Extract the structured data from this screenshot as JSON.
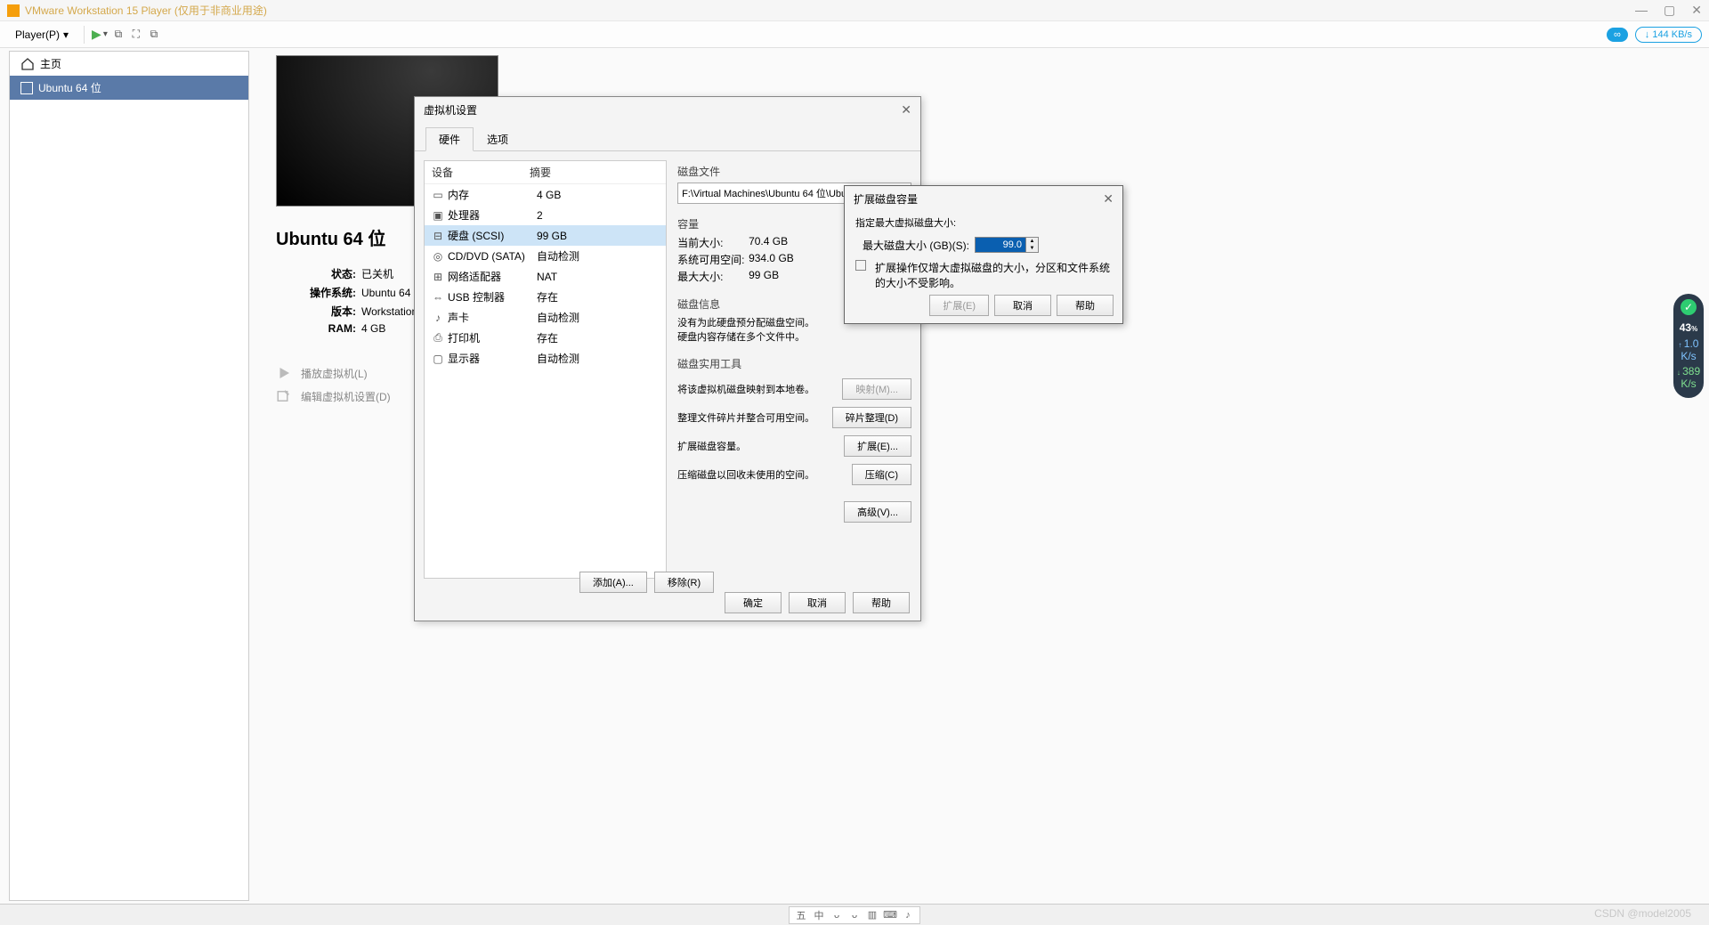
{
  "window": {
    "title": "VMware Workstation 15 Player (仅用于非商业用途)"
  },
  "toolbar": {
    "player_menu": "Player(P)",
    "net_speed": "↓ 144 KB/s"
  },
  "sidebar": {
    "home": "主页",
    "vm": "Ubuntu 64 位"
  },
  "vm": {
    "name": "Ubuntu 64 位",
    "state_label": "状态:",
    "state_value": "已关机",
    "os_label": "操作系统:",
    "os_value": "Ubuntu 64 位",
    "version_label": "版本:",
    "version_value": "Workstation 15.x 虚拟",
    "ram_label": "RAM:",
    "ram_value": "4 GB",
    "play": "播放虚拟机(L)",
    "edit": "编辑虚拟机设置(D)"
  },
  "settings": {
    "title": "虚拟机设置",
    "tab_hw": "硬件",
    "tab_opt": "选项",
    "col_device": "设备",
    "col_summary": "摘要",
    "devices": [
      {
        "name": "内存",
        "summary": "4 GB",
        "ico": "▭"
      },
      {
        "name": "处理器",
        "summary": "2",
        "ico": "▣"
      },
      {
        "name": "硬盘 (SCSI)",
        "summary": "99 GB",
        "ico": "⊟",
        "selected": true
      },
      {
        "name": "CD/DVD (SATA)",
        "summary": "自动检测",
        "ico": "◎"
      },
      {
        "name": "网络适配器",
        "summary": "NAT",
        "ico": "⊞"
      },
      {
        "name": "USB 控制器",
        "summary": "存在",
        "ico": "⇔"
      },
      {
        "name": "声卡",
        "summary": "自动检测",
        "ico": "♪"
      },
      {
        "name": "打印机",
        "summary": "存在",
        "ico": "⎙"
      },
      {
        "name": "显示器",
        "summary": "自动检测",
        "ico": "▢"
      }
    ],
    "disk_file_label": "磁盘文件",
    "disk_file": "F:\\Virtual Machines\\Ubuntu 64 位\\Ubuntu 64 位.vmx",
    "capacity_label": "容量",
    "current_size_label": "当前大小:",
    "current_size": "70.4 GB",
    "free_label": "系统可用空间:",
    "free": "934.0 GB",
    "max_label": "最大大小:",
    "max": "99 GB",
    "disk_info_label": "磁盘信息",
    "disk_info1": "没有为此硬盘预分配磁盘空间。",
    "disk_info2": "硬盘内容存储在多个文件中。",
    "utils_label": "磁盘实用工具",
    "util_map_desc": "将该虚拟机磁盘映射到本地卷。",
    "util_map_btn": "映射(M)...",
    "util_defrag_desc": "整理文件碎片并整合可用空间。",
    "util_defrag_btn": "碎片整理(D)",
    "util_expand_desc": "扩展磁盘容量。",
    "util_expand_btn": "扩展(E)...",
    "util_compact_desc": "压缩磁盘以回收未使用的空间。",
    "util_compact_btn": "压缩(C)",
    "advanced_btn": "高级(V)...",
    "add_btn": "添加(A)...",
    "remove_btn": "移除(R)",
    "ok": "确定",
    "cancel": "取消",
    "help": "帮助"
  },
  "expand": {
    "title": "扩展磁盘容量",
    "specify": "指定最大虚拟磁盘大小:",
    "max_label": "最大磁盘大小 (GB)(S):",
    "value": "99.0",
    "note": "扩展操作仅增大虚拟磁盘的大小，分区和文件系统的大小不受影响。",
    "expand_btn": "扩展(E)",
    "cancel": "取消",
    "help": "帮助"
  },
  "side_widget": {
    "pct": "43",
    "pct_unit": "%",
    "up": "1.0",
    "up_unit": "K/s",
    "dn": "389",
    "dn_unit": "K/s"
  },
  "tray": {
    "items": [
      "五",
      "中",
      "ᴗ",
      "ᴗ",
      "▥",
      "⌨",
      "♪"
    ]
  },
  "watermark": "CSDN @model2005"
}
